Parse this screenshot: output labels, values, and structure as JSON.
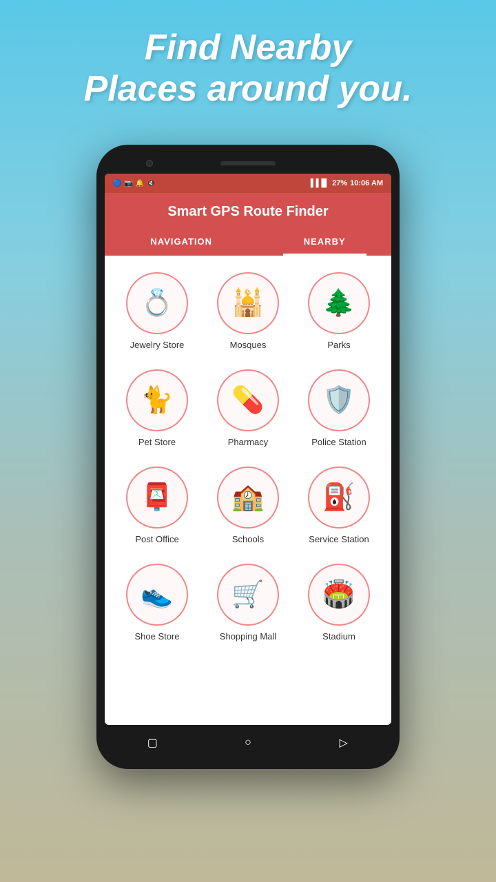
{
  "page": {
    "bg_headline_line1": "Find Nearby",
    "bg_headline_line2": "Places around you."
  },
  "status_bar": {
    "time": "10:06 AM",
    "battery": "27%",
    "signal": "▐▐▐▌"
  },
  "app": {
    "title": "Smart GPS Route Finder",
    "tabs": [
      {
        "label": "NAVIGATION",
        "active": false
      },
      {
        "label": "NEARBY",
        "active": true
      }
    ]
  },
  "categories": [
    {
      "label": "Jewelry Store",
      "emoji": "💍"
    },
    {
      "label": "Mosques",
      "emoji": "🕌"
    },
    {
      "label": "Parks",
      "emoji": "🌲"
    },
    {
      "label": "Pet Store",
      "emoji": "🐈"
    },
    {
      "label": "Pharmacy",
      "emoji": "💊"
    },
    {
      "label": "Police Station",
      "emoji": "🛡️"
    },
    {
      "label": "Post Office",
      "emoji": "📮"
    },
    {
      "label": "Schools",
      "emoji": "🏫"
    },
    {
      "label": "Service Station",
      "emoji": "⛽"
    },
    {
      "label": "Shoe Store",
      "emoji": "👟"
    },
    {
      "label": "Shopping Mall",
      "emoji": "🛒"
    },
    {
      "label": "Stadium",
      "emoji": "🏟️"
    }
  ],
  "nav_buttons": [
    "▢",
    "○",
    "▷"
  ]
}
